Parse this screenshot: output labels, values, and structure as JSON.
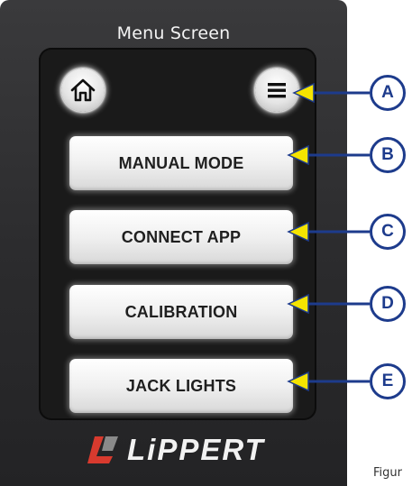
{
  "screen": {
    "title": "Menu Screen",
    "home_icon": "home-icon",
    "menu_icon": "hamburger-menu-icon",
    "items": [
      {
        "label": "MANUAL MODE"
      },
      {
        "label": "CONNECT APP"
      },
      {
        "label": "CALIBRATION"
      },
      {
        "label": "JACK LIGHTS"
      }
    ]
  },
  "logo": {
    "text": "LiPPERT",
    "mark_color": "#d83a2e"
  },
  "callouts": [
    {
      "letter": "A"
    },
    {
      "letter": "B"
    },
    {
      "letter": "C"
    },
    {
      "letter": "D"
    },
    {
      "letter": "E"
    }
  ],
  "caption": "Figur",
  "colors": {
    "callout_blue": "#1d3b8c",
    "arrow_yellow": "#f5e400",
    "bezel": "#2e2e30"
  }
}
